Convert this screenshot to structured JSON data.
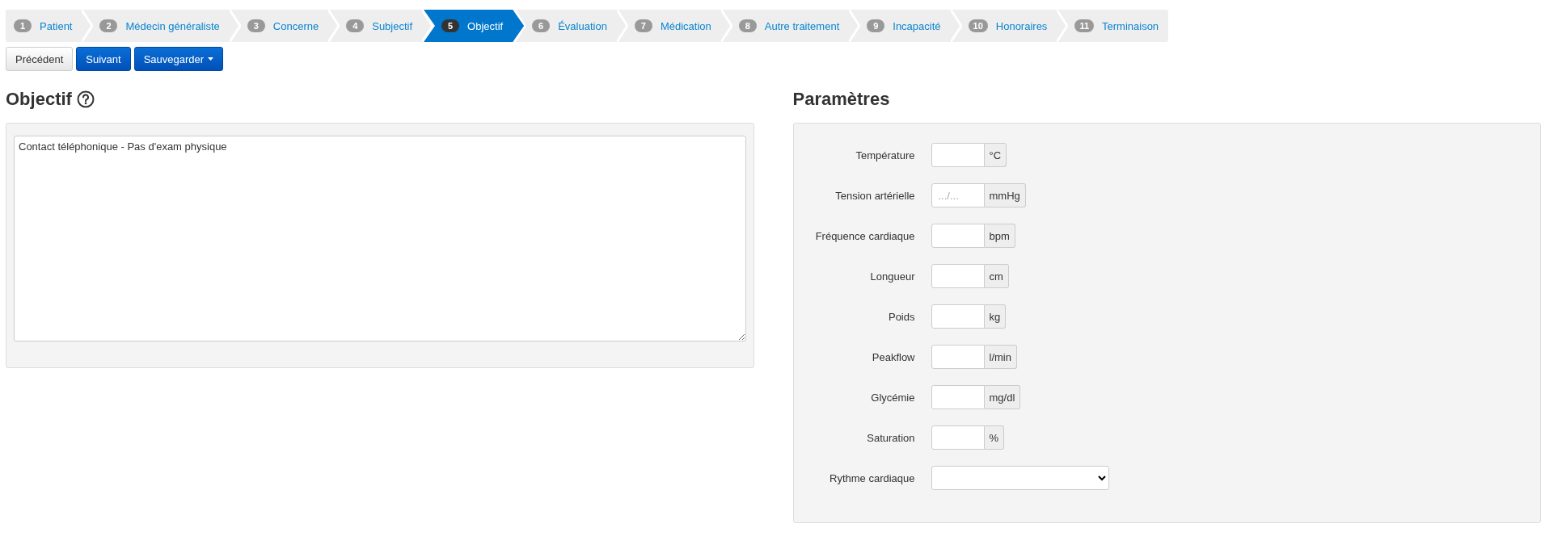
{
  "steps": [
    {
      "number": "1",
      "label": "Patient",
      "selected": false
    },
    {
      "number": "2",
      "label": "Médecin généraliste",
      "selected": false
    },
    {
      "number": "3",
      "label": "Concerne",
      "selected": false
    },
    {
      "number": "4",
      "label": "Subjectif",
      "selected": false
    },
    {
      "number": "5",
      "label": "Objectif",
      "selected": true
    },
    {
      "number": "6",
      "label": "Évaluation",
      "selected": false
    },
    {
      "number": "7",
      "label": "Médication",
      "selected": false
    },
    {
      "number": "8",
      "label": "Autre traitement",
      "selected": false
    },
    {
      "number": "9",
      "label": "Incapacité",
      "selected": false
    },
    {
      "number": "10",
      "label": "Honoraires",
      "selected": false
    },
    {
      "number": "11",
      "label": "Terminaison",
      "selected": false
    }
  ],
  "buttons": [
    {
      "label": "Précédent",
      "kind": "default"
    },
    {
      "label": "Suivant",
      "kind": "primary"
    },
    {
      "label": "Sauvegarder",
      "kind": "dropdown"
    }
  ],
  "objectif": {
    "title": "Objectif",
    "value": "Contact téléphonique - Pas d'exam physique"
  },
  "parametres": {
    "title": "Paramètres",
    "fields": [
      {
        "kind": "input",
        "label": "Température",
        "unit": "°C"
      },
      {
        "kind": "input",
        "label": "Tension artérielle",
        "placeholder": ".../...",
        "unit": "mmHg"
      },
      {
        "kind": "input",
        "label": "Fréquence cardiaque",
        "unit": "bpm"
      },
      {
        "kind": "input",
        "label": "Longueur",
        "unit": "cm"
      },
      {
        "kind": "input",
        "label": "Poids",
        "unit": "kg"
      },
      {
        "kind": "input",
        "label": "Peakflow",
        "unit": "l/min"
      },
      {
        "kind": "input",
        "label": "Glycémie",
        "unit": "mg/dl"
      },
      {
        "kind": "input",
        "label": "Saturation",
        "unit": "%"
      },
      {
        "kind": "select",
        "label": "Rythme cardiaque"
      }
    ]
  }
}
